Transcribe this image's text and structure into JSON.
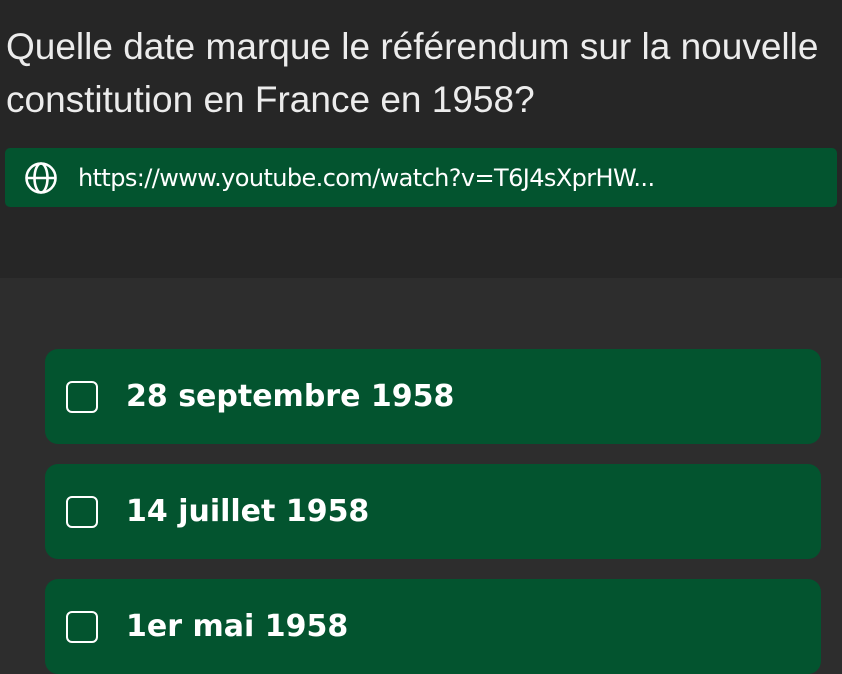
{
  "question": {
    "text": "Quelle date marque le référendum sur la nouvelle constitution en France en 1958?"
  },
  "link": {
    "icon": "globe-icon",
    "url": "https://www.youtube.com/watch?v=T6J4sXprHW..."
  },
  "options": [
    {
      "label": "28 septembre 1958",
      "checked": false
    },
    {
      "label": "14 juillet 1958",
      "checked": false
    },
    {
      "label": "1er mai 1958",
      "checked": false
    }
  ],
  "colors": {
    "background": "#2d2d2d",
    "header_background": "#262626",
    "accent_green": "#03542f",
    "text": "#ffffff"
  }
}
